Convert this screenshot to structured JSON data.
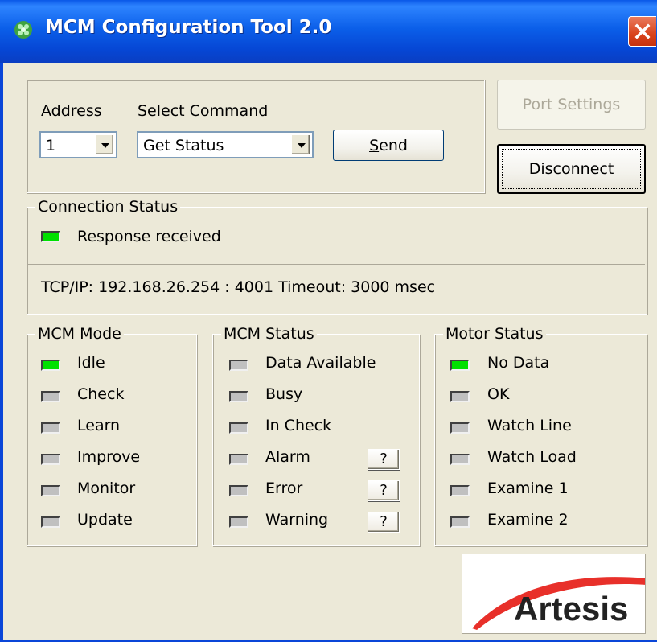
{
  "window": {
    "title": "MCM Configuration Tool 2.0",
    "icon": "app-icon",
    "close_icon": "close-icon"
  },
  "command": {
    "address_label": "Address",
    "address_value": "1",
    "command_label": "Select Command",
    "command_value": "Get Status",
    "send_label": "Send"
  },
  "buttons": {
    "port_settings": "Port Settings",
    "disconnect": "Disconnect"
  },
  "connection": {
    "title": "Connection Status",
    "response": "Response received",
    "response_on": true,
    "tcp_info": "TCP/IP: 192.168.26.254 : 4001 Timeout: 3000 msec"
  },
  "mcm_mode": {
    "title": "MCM Mode",
    "items": [
      {
        "label": "Idle",
        "on": true
      },
      {
        "label": "Check",
        "on": false
      },
      {
        "label": "Learn",
        "on": false
      },
      {
        "label": "Improve",
        "on": false
      },
      {
        "label": "Monitor",
        "on": false
      },
      {
        "label": "Update",
        "on": false
      }
    ]
  },
  "mcm_status": {
    "title": "MCM Status",
    "items": [
      {
        "label": "Data Available",
        "on": false
      },
      {
        "label": "Busy",
        "on": false
      },
      {
        "label": "In Check",
        "on": false
      },
      {
        "label": "Alarm",
        "on": false,
        "help": "?"
      },
      {
        "label": "Error",
        "on": false,
        "help": "?"
      },
      {
        "label": "Warning",
        "on": false,
        "help": "?"
      }
    ]
  },
  "motor_status": {
    "title": "Motor Status",
    "items": [
      {
        "label": "No Data",
        "on": true
      },
      {
        "label": "OK",
        "on": false
      },
      {
        "label": "Watch Line",
        "on": false
      },
      {
        "label": "Watch Load",
        "on": false
      },
      {
        "label": "Examine 1",
        "on": false
      },
      {
        "label": "Examine 2",
        "on": false
      }
    ]
  },
  "logo": {
    "text": "Artesis",
    "swoosh_color": "#e8302a"
  },
  "colors": {
    "led_on": "#00e000",
    "led_off": "#c0c0c0",
    "title_bar": "#0a58e8",
    "background": "#ece9d8"
  }
}
